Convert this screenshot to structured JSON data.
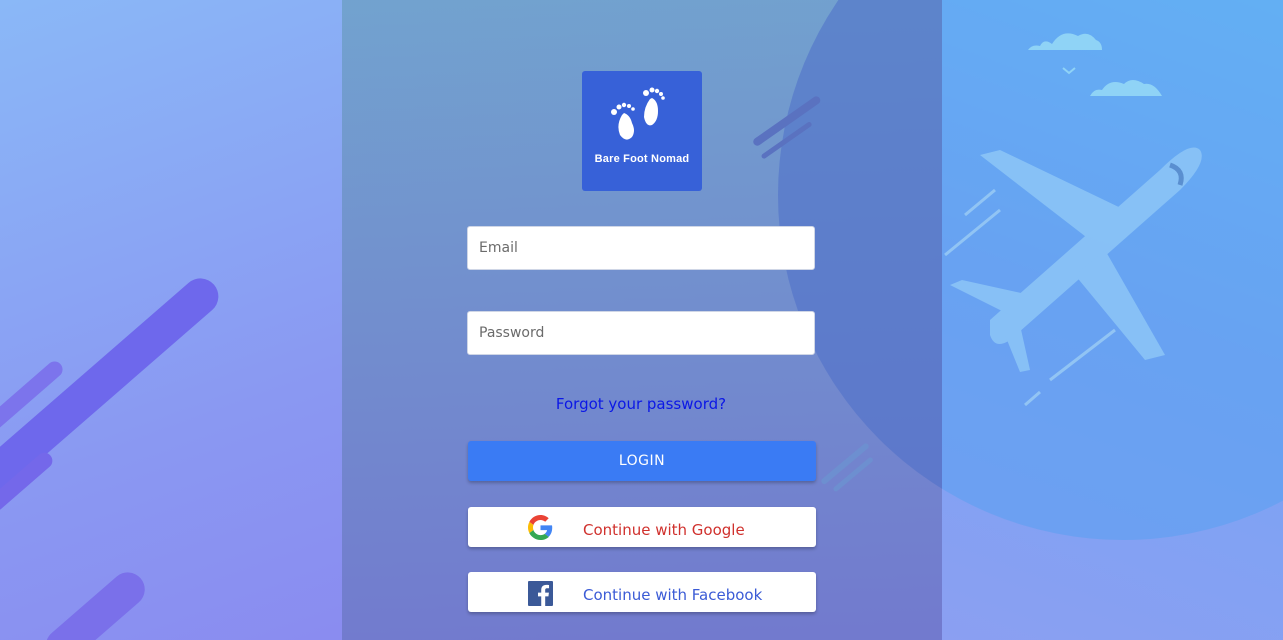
{
  "brand": {
    "name": "Bare Foot Nomad",
    "logo_icon": "footprints-icon",
    "logo_color": "#3761d8"
  },
  "login_form": {
    "email_placeholder": "Email",
    "password_placeholder": "Password",
    "forgot_link": "Forgot your password?",
    "login_label": "LOGIN"
  },
  "social": {
    "google_label": "Continue with Google",
    "google_icon": "google-icon",
    "facebook_label": "Continue with Facebook",
    "facebook_icon": "facebook-icon"
  },
  "colors": {
    "primary_button": "#3a7bf4",
    "link": "#0b17e6",
    "google_text": "#d0312d",
    "facebook_text": "#3b5bd6"
  },
  "decor": {
    "background_art": "airplane-illustration"
  }
}
